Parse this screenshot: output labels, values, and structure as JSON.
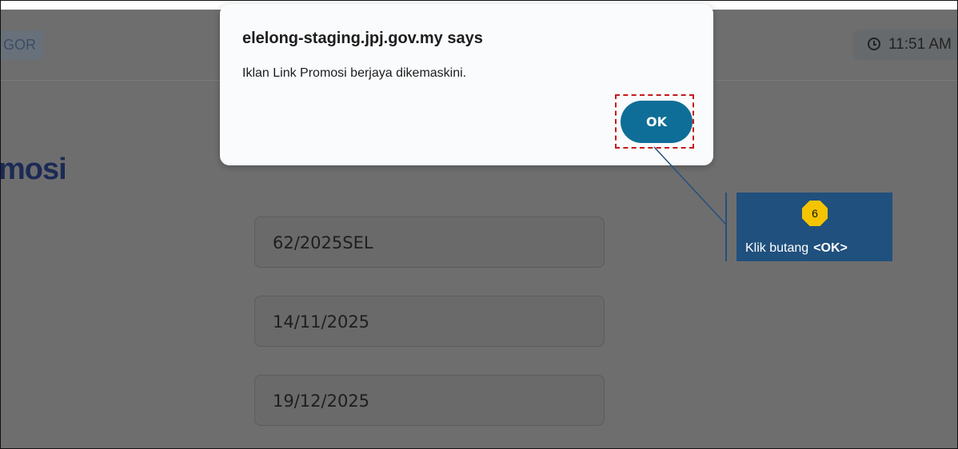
{
  "header": {
    "state_label": "GOR",
    "time": "11:51 AM"
  },
  "page": {
    "heading": "mosi"
  },
  "form": {
    "fields": [
      {
        "value": "62/2025SEL"
      },
      {
        "value": "14/11/2025"
      },
      {
        "value": "19/12/2025"
      }
    ]
  },
  "dialog": {
    "title": "elelong-staging.jpj.gov.my says",
    "message": "Iklan Link Promosi berjaya dikemaskini.",
    "ok_label": "OK"
  },
  "callout": {
    "step": "6",
    "text": "Klik butang",
    "key": "<OK>"
  },
  "colors": {
    "overlay": "#6e6e6e",
    "ok_button": "#0f6e97",
    "highlight": "#c41a1a",
    "callout_bg": "#20507d",
    "step_badge": "#f5c400"
  },
  "icons": {
    "clock": "clock-icon"
  }
}
